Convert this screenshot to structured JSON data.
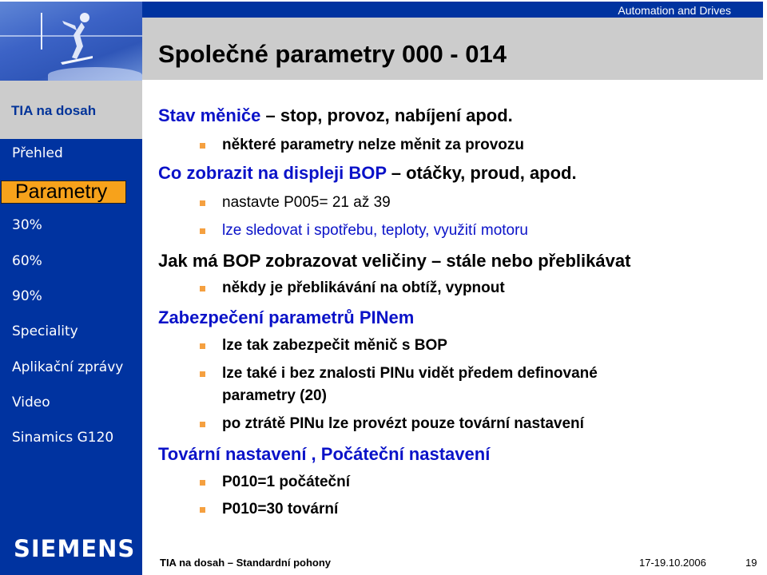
{
  "header": {
    "brand": "Automation and Drives",
    "title": "Společné parametry 000 - 014"
  },
  "sidebar": {
    "home": "TIA na dosah",
    "items": [
      {
        "label": "Přehled",
        "active": false
      },
      {
        "label": "Parametry",
        "active": true
      },
      {
        "label": "30%",
        "active": false
      },
      {
        "label": "60%",
        "active": false
      },
      {
        "label": "90%",
        "active": false
      },
      {
        "label": "Speciality",
        "active": false
      },
      {
        "label": "Aplikační zprávy",
        "active": false
      },
      {
        "label": "Video",
        "active": false
      },
      {
        "label": "Sinamics G120",
        "active": false
      }
    ],
    "logo": "SIEMENS"
  },
  "content": {
    "s1": {
      "head": "Stav měniče",
      "rest": " – stop, provoz, nabíjení apod."
    },
    "s1b1": "některé parametry nelze měnit za provozu",
    "s2": {
      "head": "Co zobrazit na displeji BOP",
      "rest": " – otáčky, proud, apod."
    },
    "s2b1": "nastavte P005= 21 až 39",
    "s2b2": "lze sledovat i spotřebu, teploty, využití motoru",
    "s3": "Jak má BOP zobrazovat veličiny – stále nebo přeblikávat",
    "s3b1": "někdy je přeblikávání na obtíž, vypnout",
    "s4": "Zabezpečení parametrů PINem",
    "s4b1": "lze tak zabezpečit měnič s BOP",
    "s4b2_l1": "lze také i bez znalosti PINu vidět předem definované",
    "s4b2_l2": "parametry (20)",
    "s4b3": "po ztrátě PINu lze provézt pouze tovární nastavení",
    "s5": "Tovární nastavení , Počáteční nastavení",
    "s5b1": "P010=1 počáteční",
    "s5b2": "P010=30 tovární"
  },
  "footer": {
    "left": "TIA na dosah – Standardní pohony",
    "date": "17-19.10.2006",
    "page": "19"
  },
  "colors": {
    "brand_blue": "#0033a0",
    "accent_orange": "#f7a21b",
    "heading_blue": "#0a12c8",
    "panel_gray": "#cccccc"
  }
}
